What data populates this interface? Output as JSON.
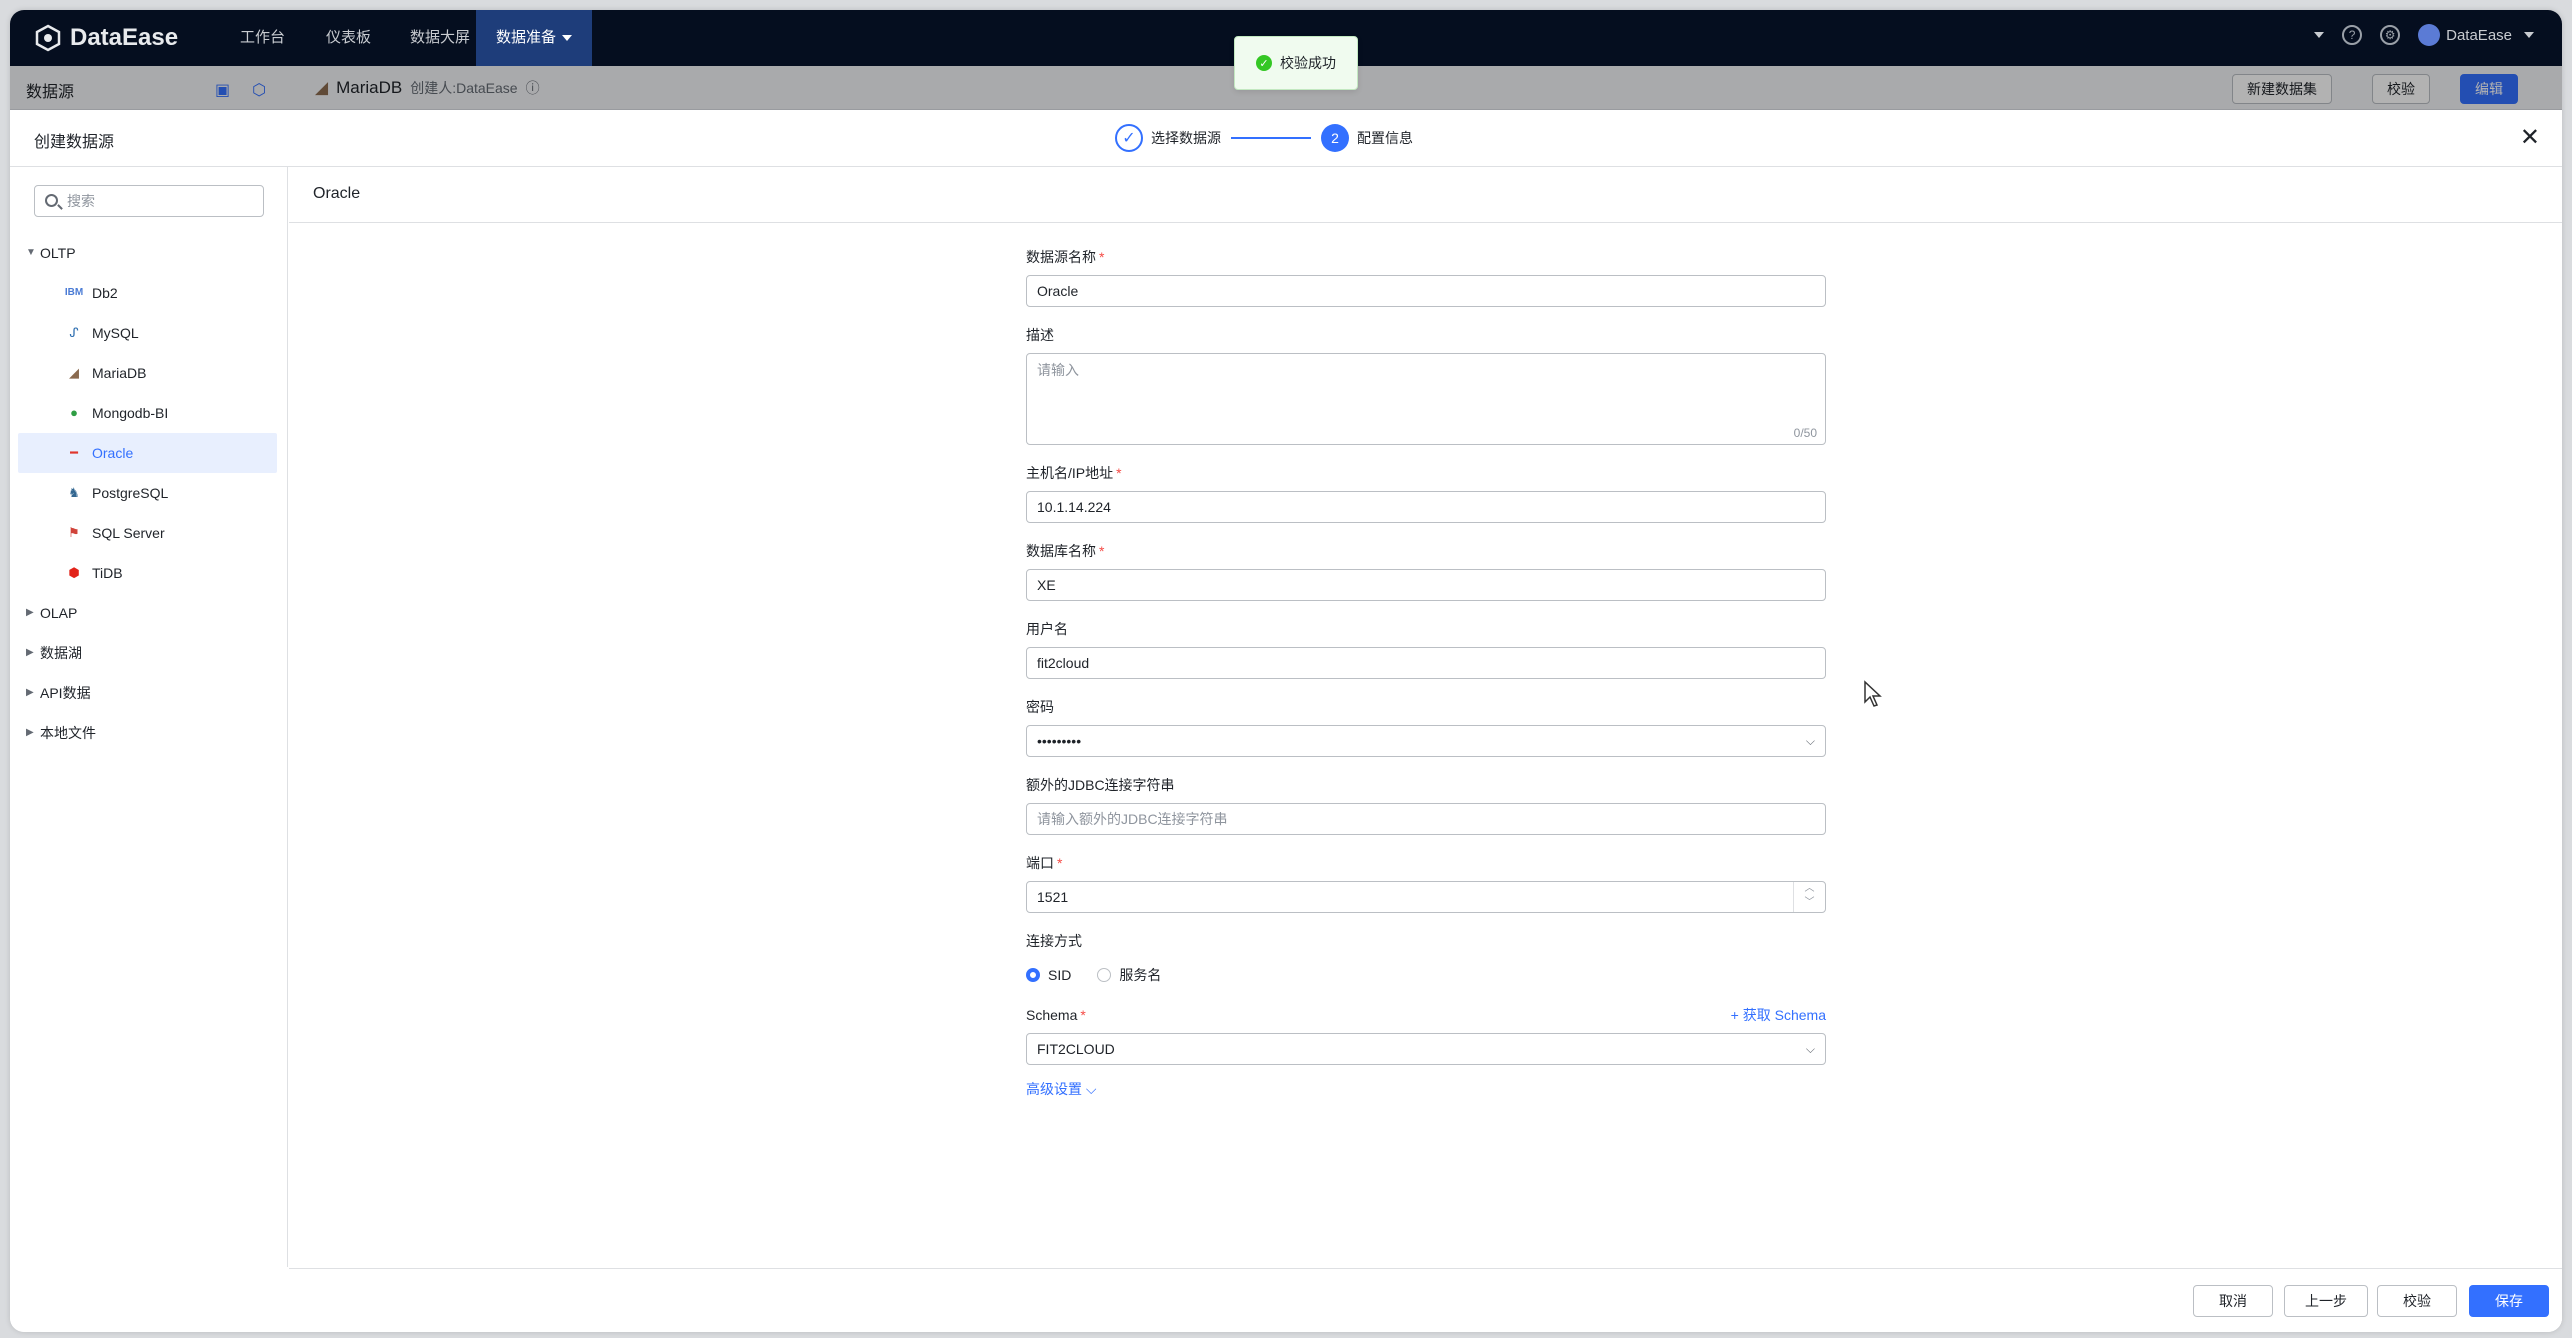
{
  "app": {
    "logo_text": "DataEase"
  },
  "nav": {
    "items": [
      {
        "label": "工作台"
      },
      {
        "label": "仪表板"
      },
      {
        "label": "数据大屏"
      },
      {
        "label": "数据准备"
      }
    ],
    "user": "DataEase"
  },
  "background_page": {
    "title": "数据源",
    "datasource_name": "MariaDB",
    "creator": "创建人:DataEase",
    "buttons": {
      "new_dataset": "新建数据集",
      "verify": "校验",
      "edit": "编辑"
    }
  },
  "toast": {
    "message": "校验成功"
  },
  "dialog": {
    "title": "创建数据源",
    "steps": [
      {
        "label": "选择数据源"
      },
      {
        "number": "2",
        "label": "配置信息"
      }
    ]
  },
  "sidebar": {
    "search_placeholder": "搜索",
    "groups": [
      {
        "label": "OLTP",
        "expanded": true
      },
      {
        "label": "OLAP"
      },
      {
        "label": "数据湖"
      },
      {
        "label": "API数据"
      },
      {
        "label": "本地文件"
      }
    ],
    "items": [
      {
        "label": "Db2",
        "icon": "ibm-icon",
        "color": "#4a7bd5"
      },
      {
        "label": "MySQL",
        "icon": "mysql-icon",
        "color": "#2f6fb1"
      },
      {
        "label": "MariaDB",
        "icon": "mariadb-icon",
        "color": "#8a6a4f"
      },
      {
        "label": "Mongodb-BI",
        "icon": "mongodb-icon",
        "color": "#2f9e44"
      },
      {
        "label": "Oracle",
        "icon": "oracle-icon",
        "color": "#e0362c",
        "selected": true
      },
      {
        "label": "PostgreSQL",
        "icon": "postgresql-icon",
        "color": "#336791"
      },
      {
        "label": "SQL Server",
        "icon": "sqlserver-icon",
        "color": "#d0433a"
      },
      {
        "label": "TiDB",
        "icon": "tidb-icon",
        "color": "#e2231a"
      }
    ]
  },
  "form": {
    "header": "Oracle",
    "name_label": "数据源名称",
    "name_value": "Oracle",
    "desc_label": "描述",
    "desc_placeholder": "请输入",
    "desc_count": "0/50",
    "host_label": "主机名/IP地址",
    "host_value": "10.1.14.224",
    "db_label": "数据库名称",
    "db_value": "XE",
    "user_label": "用户名",
    "user_value": "fit2cloud",
    "pwd_label": "密码",
    "pwd_value": "•••••••••",
    "jdbc_label": "额外的JDBC连接字符串",
    "jdbc_placeholder": "请输入额外的JDBC连接字符串",
    "port_label": "端口",
    "port_value": "1521",
    "conn_label": "连接方式",
    "conn_sid": "SID",
    "conn_service": "服务名",
    "schema_label": "Schema",
    "schema_fetch": "+ 获取 Schema",
    "schema_value": "FIT2CLOUD",
    "advanced": "高级设置"
  },
  "footer": {
    "cancel": "取消",
    "prev": "上一步",
    "verify": "校验",
    "save": "保存"
  },
  "colors": {
    "primary": "#3370ff",
    "nav_bg": "#050e1f",
    "success": "#34c724"
  }
}
